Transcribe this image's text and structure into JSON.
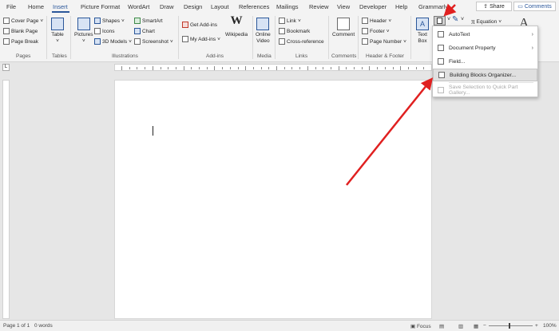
{
  "tabs": [
    "File",
    "Home",
    "Insert",
    "Picture Format",
    "WordArt",
    "Draw",
    "Design",
    "Layout",
    "References",
    "Mailings",
    "Review",
    "View",
    "Developer",
    "Help",
    "Grammarly"
  ],
  "active_tab": "Insert",
  "share_label": "Share",
  "comments_label": "Comments",
  "ribbon": {
    "pages": {
      "label": "Pages",
      "items": [
        "Cover Page",
        "Blank Page",
        "Page Break"
      ]
    },
    "tables": {
      "label": "Tables",
      "table": "Table"
    },
    "illustrations": {
      "label": "Illustrations",
      "pictures": "Pictures",
      "shapes": "Shapes",
      "icons": "Icons",
      "models": "3D Models",
      "smartart": "SmartArt",
      "chart": "Chart",
      "screenshot": "Screenshot"
    },
    "addins": {
      "label": "Add-ins",
      "get": "Get Add-ins",
      "my": "My Add-ins",
      "wikipedia": "Wikipedia"
    },
    "media": {
      "label": "Media",
      "online_video_1": "Online",
      "online_video_2": "Video"
    },
    "links": {
      "label": "Links",
      "link": "Link",
      "bookmark": "Bookmark",
      "cross": "Cross-reference"
    },
    "comments": {
      "label": "Comments",
      "comment": "Comment"
    },
    "header_footer": {
      "label": "Header & Footer",
      "header": "Header",
      "footer": "Footer",
      "page_number": "Page Number"
    },
    "text": {
      "textbox_1": "Text",
      "textbox_2": "Box",
      "equation": "Equation"
    }
  },
  "dropdown": {
    "items": [
      {
        "label": "AutoText",
        "submenu": true,
        "state": "normal"
      },
      {
        "label": "Document Property",
        "submenu": true,
        "state": "normal"
      },
      {
        "label": "Field...",
        "submenu": false,
        "state": "normal"
      },
      {
        "label": "Building Blocks Organizer...",
        "submenu": false,
        "state": "highlighted"
      },
      {
        "label": "Save Selection to Quick Part Gallery...",
        "submenu": false,
        "state": "disabled"
      }
    ]
  },
  "status": {
    "page": "Page 1 of 1",
    "words": "0 words",
    "focus": "Focus",
    "zoom": "100%"
  },
  "colors": {
    "accent": "#2b579a",
    "arrow": "#e02020"
  }
}
